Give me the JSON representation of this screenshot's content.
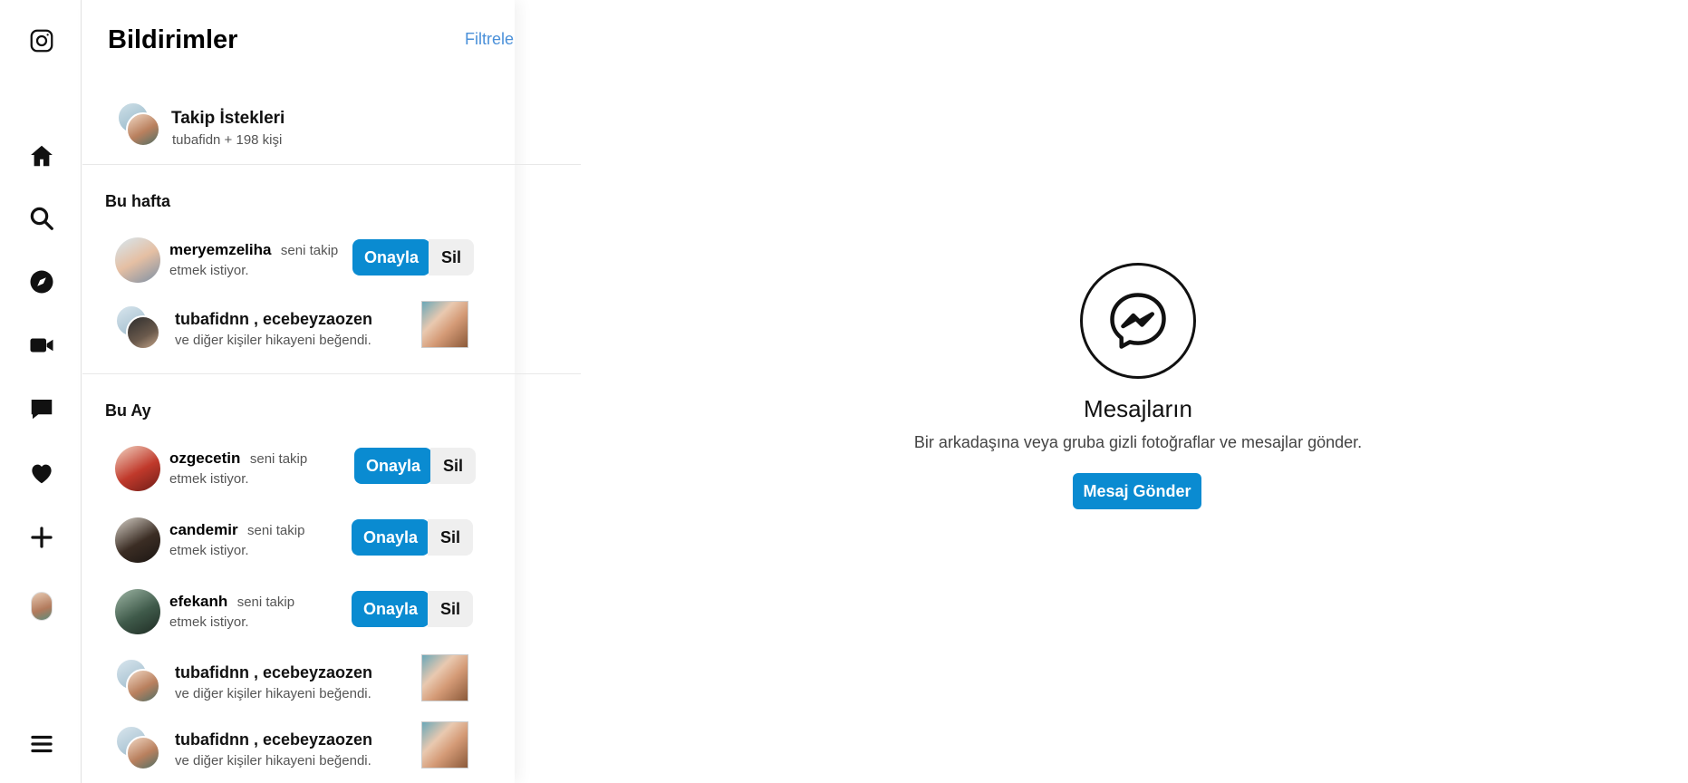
{
  "rail": {
    "items": [
      "instagram-logo",
      "home",
      "search",
      "explore",
      "reels",
      "messages",
      "notifications",
      "create",
      "profile",
      "more"
    ]
  },
  "panel": {
    "title": "Bildirimler",
    "filter_label": "Filtrele",
    "follow_requests": {
      "title": "Takip İstekleri",
      "subtitle": "tubafidn + 198 kişi"
    },
    "sections": [
      {
        "heading": "Bu hafta",
        "rows": [
          {
            "type": "request",
            "username": "meryemzeliha",
            "text_a": "seni takip",
            "text_b": "etmek istiyor.",
            "approve": "Onayla",
            "delete": "Sil"
          },
          {
            "type": "story",
            "names": "tubafidnn , ecebeyzaozen",
            "text": "ve diğer kişiler hikayeni beğendi."
          }
        ]
      },
      {
        "heading": "Bu Ay",
        "rows": [
          {
            "type": "request",
            "username": "ozgecetin",
            "text_a": "seni takip",
            "text_b": "etmek istiyor.",
            "approve": "Onayla",
            "delete": "Sil"
          },
          {
            "type": "request",
            "username": "candemir",
            "text_a": "seni takip",
            "text_b": "etmek istiyor.",
            "approve": "Onayla",
            "delete": "Sil"
          },
          {
            "type": "request",
            "username": "efekanh",
            "text_a": "seni takip",
            "text_b": "etmek istiyor.",
            "approve": "Onayla",
            "delete": "Sil"
          },
          {
            "type": "story",
            "names": "tubafidnn , ecebeyzaozen",
            "text": "ve diğer kişiler hikayeni beğendi."
          },
          {
            "type": "story",
            "names": "tubafidnn , ecebeyzaozen",
            "text": "ve diğer kişiler hikayeni beğendi."
          }
        ]
      }
    ]
  },
  "messages": {
    "title": "Mesajların",
    "subtitle": "Bir arkadaşına veya gruba gizli fotoğraflar ve mesajlar gönder.",
    "button": "Mesaj Gönder"
  },
  "colors": {
    "accent": "#0a8bd1",
    "link": "#4a90d9",
    "delete_bg": "#efefef"
  }
}
